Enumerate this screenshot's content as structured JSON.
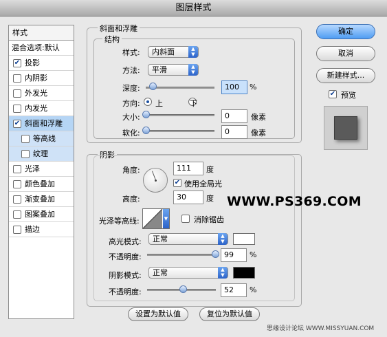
{
  "window": {
    "title": "图层样式"
  },
  "left": {
    "header": "样式",
    "blend": "混合选项:默认",
    "items": [
      {
        "label": "投影",
        "checked": true
      },
      {
        "label": "内阴影",
        "checked": false
      },
      {
        "label": "外发光",
        "checked": false
      },
      {
        "label": "内发光",
        "checked": false
      },
      {
        "label": "斜面和浮雕",
        "checked": true
      },
      {
        "label": "等高线",
        "checked": false
      },
      {
        "label": "纹理",
        "checked": false
      },
      {
        "label": "光泽",
        "checked": false
      },
      {
        "label": "颜色叠加",
        "checked": false
      },
      {
        "label": "渐变叠加",
        "checked": false
      },
      {
        "label": "图案叠加",
        "checked": false
      },
      {
        "label": "描边",
        "checked": false
      }
    ],
    "check_mark": "✔"
  },
  "bevel": {
    "group_title": "斜面和浮雕",
    "structure_title": "结构",
    "style_label": "样式:",
    "style_value": "内斜面",
    "technique_label": "方法:",
    "technique_value": "平滑",
    "depth_label": "深度:",
    "depth_value": "100",
    "depth_unit": "%",
    "depth_pct": 0.1,
    "direction_label": "方向:",
    "up_label": "上",
    "down_label": "下",
    "size_label": "大小:",
    "size_value": "0",
    "size_unit": "像素",
    "size_pct": 0.0,
    "soften_label": "软化:",
    "soften_value": "0",
    "soften_unit": "像素",
    "soften_pct": 0.0
  },
  "shading": {
    "group_title": "阴影",
    "angle_label": "角度:",
    "angle_value": "111",
    "angle_unit": "度",
    "global_light_label": "使用全局光",
    "altitude_label": "高度:",
    "altitude_value": "30",
    "altitude_unit": "度",
    "gloss_label": "光泽等高线:",
    "antialias_label": "消除锯齿",
    "highlight_mode_label": "高光模式:",
    "highlight_mode_value": "正常",
    "highlight_color": "#ffffff",
    "highlight_opacity_label": "不透明度:",
    "highlight_opacity_value": "99",
    "highlight_opacity_unit": "%",
    "highlight_opacity_pct": 0.99,
    "shadow_mode_label": "阴影模式:",
    "shadow_mode_value": "正常",
    "shadow_color": "#000000",
    "shadow_opacity_label": "不透明度:",
    "shadow_opacity_value": "52",
    "shadow_opacity_unit": "%",
    "shadow_opacity_pct": 0.52
  },
  "footer": {
    "set_default": "设置为默认值",
    "reset_default": "复位为默认值"
  },
  "right": {
    "ok": "确定",
    "cancel": "取消",
    "new_style": "新建样式...",
    "preview": "预览"
  },
  "watermark": "WWW.PS369.COM",
  "credit": "思缘设计论坛 WWW.MISSYUAN.COM"
}
